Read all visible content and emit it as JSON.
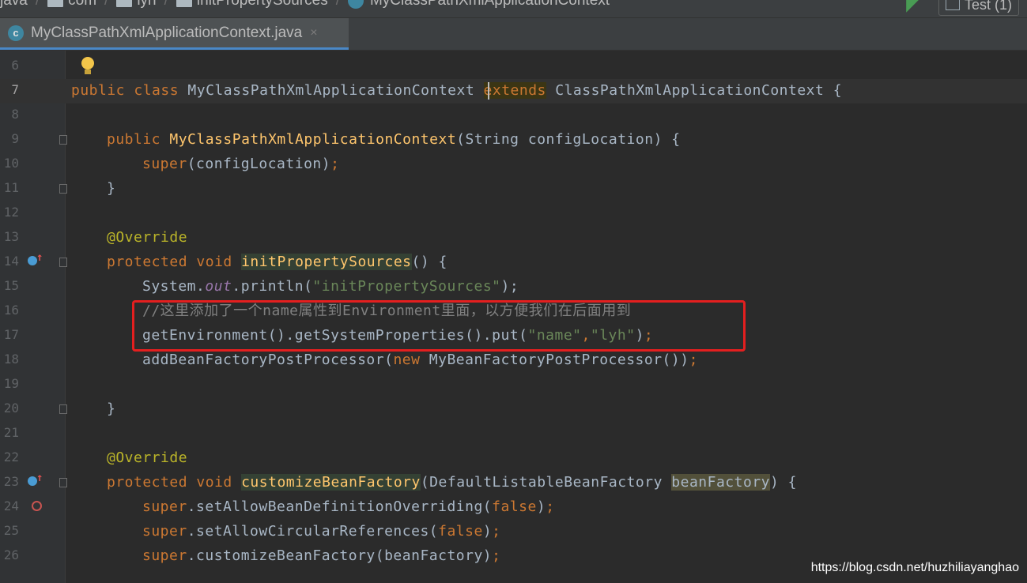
{
  "breadcrumb": {
    "items": [
      "java",
      "com",
      "lyh",
      "initPropertySources",
      "MyClassPathXmlApplicationContext"
    ],
    "run_config": "Test (1)"
  },
  "tab": {
    "title": "MyClassPathXmlApplicationContext.java",
    "icon_letter": "c",
    "close": "×"
  },
  "colors": {
    "keyword": "#cc7832",
    "method": "#ffc66d",
    "string": "#6a8759",
    "annotation": "#bbb529",
    "comment": "#808080",
    "highlight_box": "#e41f1f"
  },
  "editor": {
    "line_numbers": [
      "6",
      "7",
      "8",
      "9",
      "10",
      "11",
      "12",
      "13",
      "14",
      "15",
      "16",
      "17",
      "18",
      "19",
      "20",
      "21",
      "22",
      "23",
      "24",
      "25",
      "26"
    ],
    "code": {
      "l7": {
        "public": "public",
        "class": "class",
        "name": "MyClassPathXmlApplicationContext",
        "ext_a": "e",
        "ext_b": "xtends",
        "parent": "ClassPathXmlApplicationContext",
        "brace": "{"
      },
      "l9": {
        "public": "public",
        "ctor": "MyClassPathXmlApplicationContext",
        "params": "(String configLocation) {"
      },
      "l10": {
        "super": "super",
        "args": "(configLocation)",
        "semi": ";"
      },
      "l11": {
        "brace": "}"
      },
      "l13": {
        "ann": "@Override"
      },
      "l14": {
        "protected": "protected",
        "void": "void",
        "fn": "initPropertySources",
        "rest": "() {"
      },
      "l15": {
        "obj": "System.",
        "out": "out",
        "call": ".println(",
        "str": "\"initPropertySources\"",
        "end": ");"
      },
      "l16": {
        "comment": "//这里添加了一个name属性到Environment里面，以方便我们在后面用到"
      },
      "l17": {
        "call": "getEnvironment().getSystemProperties().put(",
        "s1": "\"name\"",
        "comma": ",",
        "s2": "\"lyh\"",
        "end": ")",
        "semi": ";"
      },
      "l18": {
        "call": "addBeanFactoryPostProcessor(",
        "new": "new",
        "cls": " MyBeanFactoryPostProcessor())",
        "semi": ";"
      },
      "l20": {
        "brace": "}"
      },
      "l22": {
        "ann": "@Override"
      },
      "l23": {
        "protected": "protected",
        "void": "void",
        "fn": "customizeBeanFactory",
        "params": "(DefaultListableBeanFactory ",
        "param": "beanFactory",
        "rest": ") {"
      },
      "l24": {
        "super": "super",
        "call": ".setAllowBeanDefinitionOverriding(",
        "val": "false",
        "end": ")",
        "semi": ";"
      },
      "l25": {
        "super": "super",
        "call": ".setAllowCircularReferences(",
        "val": "false",
        "end": ")",
        "semi": ";"
      },
      "l26": {
        "super": "super",
        "call": ".customizeBeanFactory(beanFactory)",
        "semi": ";"
      }
    }
  },
  "watermark": "https://blog.csdn.net/huzhiliayanghao"
}
